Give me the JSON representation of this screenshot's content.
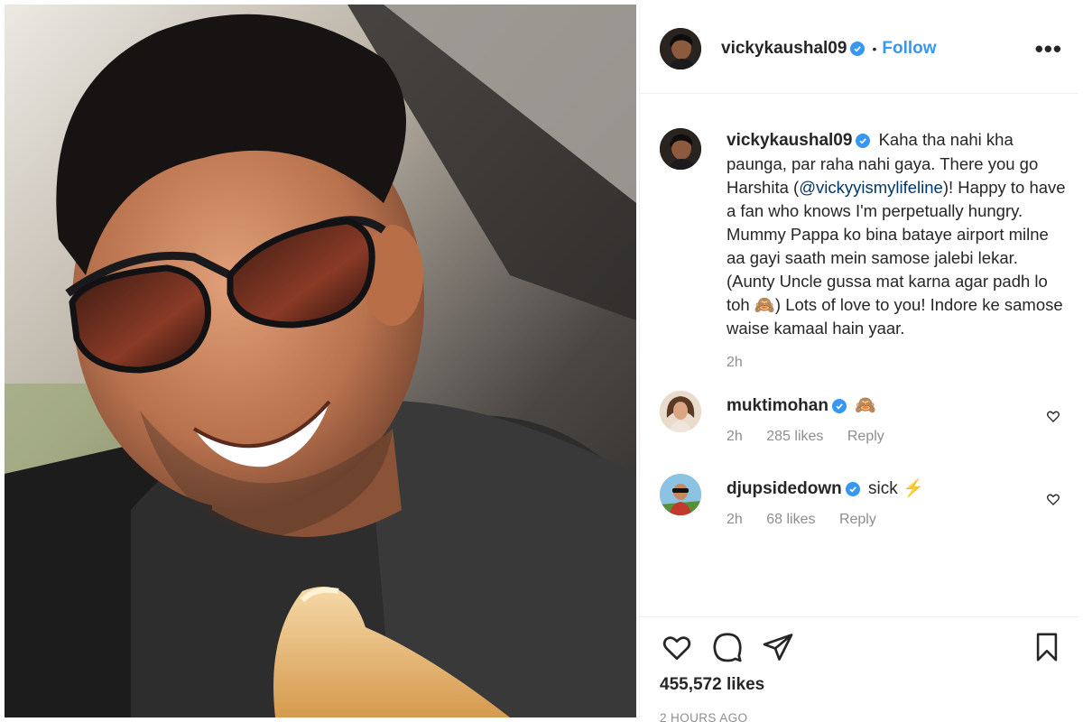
{
  "post": {
    "photo_alt": "selfie photo",
    "author": "vickykaushal09",
    "dot": "•",
    "follow_label": "Follow",
    "more_label": "•••"
  },
  "caption": {
    "username": "vickykaushal09",
    "text_before": "Kaha tha nahi kha paunga, par raha nahi gaya. There you go Harshita (",
    "mention": "@vickyyismylifeline",
    "text_after": ")! Happy to have a fan who knows I'm perpetually hungry. Mummy Pappa ko bina bataye airport milne aa gayi saath mein samose jalebi lekar. (Aunty Uncle gussa mat karna agar padh lo toh 🙈) Lots of love to you! Indore ke samose waise kamaal hain yaar.",
    "time": "2h"
  },
  "comments": [
    {
      "username": "muktimohan",
      "text": "🙈",
      "time": "2h",
      "likes": "285 likes",
      "reply": "Reply"
    },
    {
      "username": "djupsidedown",
      "text": "sick ⚡",
      "time": "2h",
      "likes": "68 likes",
      "reply": "Reply"
    }
  ],
  "footer": {
    "likes": "455,572 likes",
    "time_ago": "2 HOURS AGO"
  },
  "icons": {
    "verified": "verified-badge-icon",
    "like": "heart-icon",
    "comment": "comment-icon",
    "share": "share-icon",
    "save": "bookmark-icon",
    "comment_like": "heart-icon"
  },
  "colors": {
    "link": "#3897f0",
    "mention": "#00376b",
    "muted": "#8e8e8e",
    "text": "#262626"
  }
}
